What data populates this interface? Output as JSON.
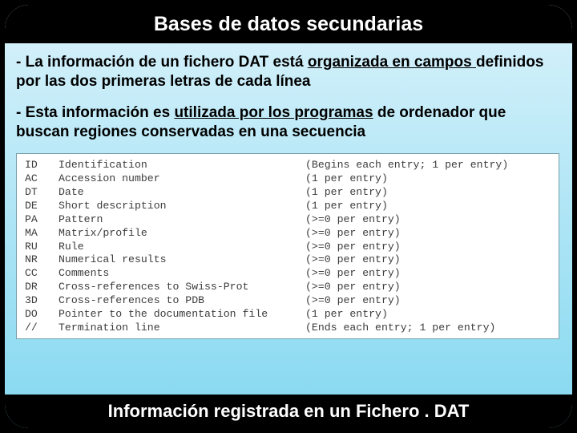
{
  "title": "Bases de datos secundarias",
  "footer": "Información registrada en un Fichero . DAT",
  "p1_a": "- La información de un fichero DAT está ",
  "p1_u": "organizada en campos ",
  "p1_b": "definidos por las dos primeras letras de cada línea",
  "p2_a": "- Esta información es ",
  "p2_u": "utilizada por los programas",
  "p2_b": " de ordenador que buscan regiones conservadas en una secuencia",
  "fields": [
    {
      "code": "ID",
      "label": "Identification",
      "note": "(Begins each entry; 1 per entry)"
    },
    {
      "code": "AC",
      "label": "Accession number",
      "note": "(1 per entry)"
    },
    {
      "code": "DT",
      "label": "Date",
      "note": "(1 per entry)"
    },
    {
      "code": "DE",
      "label": "Short description",
      "note": "(1 per entry)"
    },
    {
      "code": "PA",
      "label": "Pattern",
      "note": "(>=0 per entry)"
    },
    {
      "code": "MA",
      "label": "Matrix/profile",
      "note": "(>=0 per entry)"
    },
    {
      "code": "RU",
      "label": "Rule",
      "note": "(>=0 per entry)"
    },
    {
      "code": "NR",
      "label": "Numerical results",
      "note": "(>=0 per entry)"
    },
    {
      "code": "CC",
      "label": "Comments",
      "note": "(>=0 per entry)"
    },
    {
      "code": "DR",
      "label": "Cross-references to Swiss-Prot",
      "note": "(>=0 per entry)"
    },
    {
      "code": "3D",
      "label": "Cross-references to PDB",
      "note": "(>=0 per entry)"
    },
    {
      "code": "DO",
      "label": "Pointer to the documentation file",
      "note": "(1 per entry)"
    },
    {
      "code": "//",
      "label": "Termination line",
      "note": "(Ends each entry; 1 per entry)"
    }
  ]
}
